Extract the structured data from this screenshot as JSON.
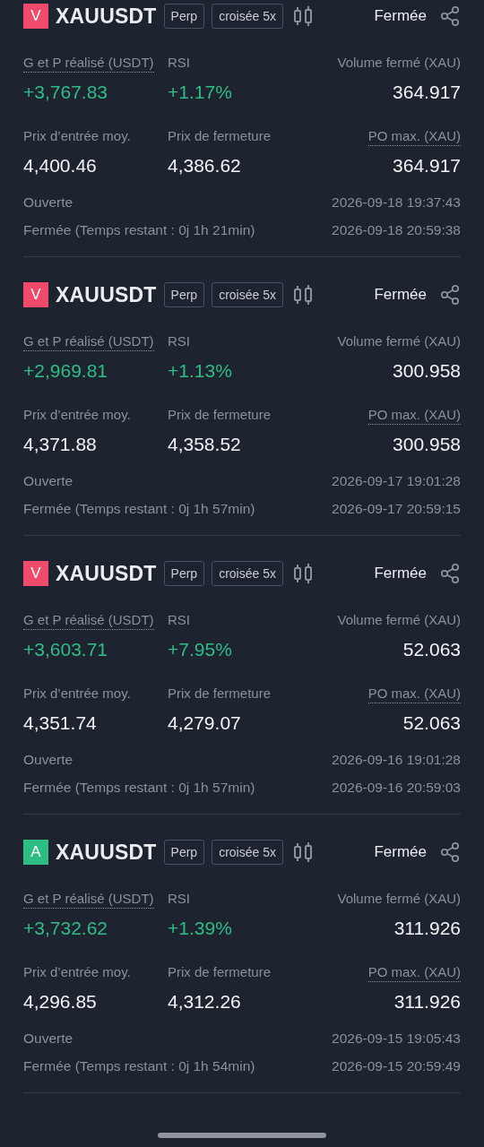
{
  "cards": [
    {
      "side": {
        "letter": "V",
        "color": "#ef4a6a"
      },
      "symbol": "XAUUSDT",
      "tags": [
        "Perp",
        "croisée 5x"
      ],
      "status": "Fermée",
      "stats": [
        {
          "label": "G et P réalisé (USDT)",
          "underlined": true,
          "value": "+3,767.83",
          "positive": true
        },
        {
          "label": "RSI",
          "underlined": false,
          "value": "+1.17%",
          "positive": true
        },
        {
          "label": "Volume fermé (XAU)",
          "underlined": false,
          "value": "364.917",
          "positive": false
        },
        {
          "label": "Prix d’entrée moy.",
          "underlined": false,
          "value": "4,400.46",
          "positive": false
        },
        {
          "label": "Prix de fermeture",
          "underlined": false,
          "value": "4,386.62",
          "positive": false
        },
        {
          "label": "PO max. (XAU)",
          "underlined": true,
          "value": "364.917",
          "positive": false
        }
      ],
      "times": [
        {
          "label": "Ouverte",
          "value": "2026-09-18 19:37:43"
        },
        {
          "label": "Fermée (Temps restant : 0j 1h 21min)",
          "value": "2026-09-18 20:59:38"
        }
      ]
    },
    {
      "side": {
        "letter": "V",
        "color": "#ef4a6a"
      },
      "symbol": "XAUUSDT",
      "tags": [
        "Perp",
        "croisée 5x"
      ],
      "status": "Fermée",
      "stats": [
        {
          "label": "G et P réalisé (USDT)",
          "underlined": true,
          "value": "+2,969.81",
          "positive": true
        },
        {
          "label": "RSI",
          "underlined": false,
          "value": "+1.13%",
          "positive": true
        },
        {
          "label": "Volume fermé (XAU)",
          "underlined": false,
          "value": "300.958",
          "positive": false
        },
        {
          "label": "Prix d’entrée moy.",
          "underlined": false,
          "value": "4,371.88",
          "positive": false
        },
        {
          "label": "Prix de fermeture",
          "underlined": false,
          "value": "4,358.52",
          "positive": false
        },
        {
          "label": "PO max. (XAU)",
          "underlined": true,
          "value": "300.958",
          "positive": false
        }
      ],
      "times": [
        {
          "label": "Ouverte",
          "value": "2026-09-17 19:01:28"
        },
        {
          "label": "Fermée (Temps restant : 0j 1h 57min)",
          "value": "2026-09-17 20:59:15"
        }
      ]
    },
    {
      "side": {
        "letter": "V",
        "color": "#ef4a6a"
      },
      "symbol": "XAUUSDT",
      "tags": [
        "Perp",
        "croisée 5x"
      ],
      "status": "Fermée",
      "stats": [
        {
          "label": "G et P réalisé (USDT)",
          "underlined": true,
          "value": "+3,603.71",
          "positive": true
        },
        {
          "label": "RSI",
          "underlined": false,
          "value": "+7.95%",
          "positive": true
        },
        {
          "label": "Volume fermé (XAU)",
          "underlined": false,
          "value": "52.063",
          "positive": false
        },
        {
          "label": "Prix d’entrée moy.",
          "underlined": false,
          "value": "4,351.74",
          "positive": false
        },
        {
          "label": "Prix de fermeture",
          "underlined": false,
          "value": "4,279.07",
          "positive": false
        },
        {
          "label": "PO max. (XAU)",
          "underlined": true,
          "value": "52.063",
          "positive": false
        }
      ],
      "times": [
        {
          "label": "Ouverte",
          "value": "2026-09-16 19:01:28"
        },
        {
          "label": "Fermée (Temps restant : 0j 1h 57min)",
          "value": "2026-09-16 20:59:03"
        }
      ]
    },
    {
      "side": {
        "letter": "A",
        "color": "#2ebd85"
      },
      "symbol": "XAUUSDT",
      "tags": [
        "Perp",
        "croisée 5x"
      ],
      "status": "Fermée",
      "stats": [
        {
          "label": "G et P réalisé (USDT)",
          "underlined": true,
          "value": "+3,732.62",
          "positive": true
        },
        {
          "label": "RSI",
          "underlined": false,
          "value": "+1.39%",
          "positive": true
        },
        {
          "label": "Volume fermé (XAU)",
          "underlined": false,
          "value": "311.926",
          "positive": false
        },
        {
          "label": "Prix d’entrée moy.",
          "underlined": false,
          "value": "4,296.85",
          "positive": false
        },
        {
          "label": "Prix de fermeture",
          "underlined": false,
          "value": "4,312.26",
          "positive": false
        },
        {
          "label": "PO max. (XAU)",
          "underlined": true,
          "value": "311.926",
          "positive": false
        }
      ],
      "times": [
        {
          "label": "Ouverte",
          "value": "2026-09-15 19:05:43"
        },
        {
          "label": "Fermée (Temps restant : 0j 1h 54min)",
          "value": "2026-09-15 20:59:49"
        }
      ]
    }
  ]
}
